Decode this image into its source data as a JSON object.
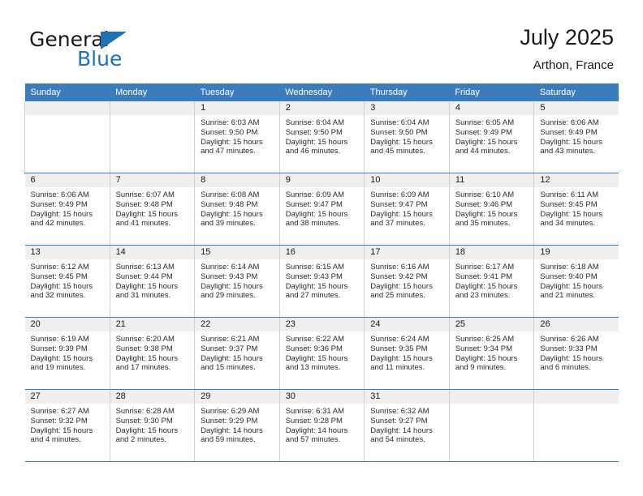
{
  "brand": {
    "name_part1": "General",
    "name_part2": "Blue",
    "flag_color": "#1e72b8"
  },
  "header": {
    "title": "July 2025",
    "subtitle": "Arthon, France",
    "header_bg": "#3a7cbe",
    "daynum_bg": "#efefef"
  },
  "weekday_headers": [
    "Sunday",
    "Monday",
    "Tuesday",
    "Wednesday",
    "Thursday",
    "Friday",
    "Saturday"
  ],
  "weeks": [
    [
      {
        "day": "",
        "sunrise": "",
        "sunset": "",
        "daylight1": "",
        "daylight2": ""
      },
      {
        "day": "",
        "sunrise": "",
        "sunset": "",
        "daylight1": "",
        "daylight2": ""
      },
      {
        "day": "1",
        "sunrise": "Sunrise: 6:03 AM",
        "sunset": "Sunset: 9:50 PM",
        "daylight1": "Daylight: 15 hours",
        "daylight2": "and 47 minutes."
      },
      {
        "day": "2",
        "sunrise": "Sunrise: 6:04 AM",
        "sunset": "Sunset: 9:50 PM",
        "daylight1": "Daylight: 15 hours",
        "daylight2": "and 46 minutes."
      },
      {
        "day": "3",
        "sunrise": "Sunrise: 6:04 AM",
        "sunset": "Sunset: 9:50 PM",
        "daylight1": "Daylight: 15 hours",
        "daylight2": "and 45 minutes."
      },
      {
        "day": "4",
        "sunrise": "Sunrise: 6:05 AM",
        "sunset": "Sunset: 9:49 PM",
        "daylight1": "Daylight: 15 hours",
        "daylight2": "and 44 minutes."
      },
      {
        "day": "5",
        "sunrise": "Sunrise: 6:06 AM",
        "sunset": "Sunset: 9:49 PM",
        "daylight1": "Daylight: 15 hours",
        "daylight2": "and 43 minutes."
      }
    ],
    [
      {
        "day": "6",
        "sunrise": "Sunrise: 6:06 AM",
        "sunset": "Sunset: 9:49 PM",
        "daylight1": "Daylight: 15 hours",
        "daylight2": "and 42 minutes."
      },
      {
        "day": "7",
        "sunrise": "Sunrise: 6:07 AM",
        "sunset": "Sunset: 9:48 PM",
        "daylight1": "Daylight: 15 hours",
        "daylight2": "and 41 minutes."
      },
      {
        "day": "8",
        "sunrise": "Sunrise: 6:08 AM",
        "sunset": "Sunset: 9:48 PM",
        "daylight1": "Daylight: 15 hours",
        "daylight2": "and 39 minutes."
      },
      {
        "day": "9",
        "sunrise": "Sunrise: 6:09 AM",
        "sunset": "Sunset: 9:47 PM",
        "daylight1": "Daylight: 15 hours",
        "daylight2": "and 38 minutes."
      },
      {
        "day": "10",
        "sunrise": "Sunrise: 6:09 AM",
        "sunset": "Sunset: 9:47 PM",
        "daylight1": "Daylight: 15 hours",
        "daylight2": "and 37 minutes."
      },
      {
        "day": "11",
        "sunrise": "Sunrise: 6:10 AM",
        "sunset": "Sunset: 9:46 PM",
        "daylight1": "Daylight: 15 hours",
        "daylight2": "and 35 minutes."
      },
      {
        "day": "12",
        "sunrise": "Sunrise: 6:11 AM",
        "sunset": "Sunset: 9:45 PM",
        "daylight1": "Daylight: 15 hours",
        "daylight2": "and 34 minutes."
      }
    ],
    [
      {
        "day": "13",
        "sunrise": "Sunrise: 6:12 AM",
        "sunset": "Sunset: 9:45 PM",
        "daylight1": "Daylight: 15 hours",
        "daylight2": "and 32 minutes."
      },
      {
        "day": "14",
        "sunrise": "Sunrise: 6:13 AM",
        "sunset": "Sunset: 9:44 PM",
        "daylight1": "Daylight: 15 hours",
        "daylight2": "and 31 minutes."
      },
      {
        "day": "15",
        "sunrise": "Sunrise: 6:14 AM",
        "sunset": "Sunset: 9:43 PM",
        "daylight1": "Daylight: 15 hours",
        "daylight2": "and 29 minutes."
      },
      {
        "day": "16",
        "sunrise": "Sunrise: 6:15 AM",
        "sunset": "Sunset: 9:43 PM",
        "daylight1": "Daylight: 15 hours",
        "daylight2": "and 27 minutes."
      },
      {
        "day": "17",
        "sunrise": "Sunrise: 6:16 AM",
        "sunset": "Sunset: 9:42 PM",
        "daylight1": "Daylight: 15 hours",
        "daylight2": "and 25 minutes."
      },
      {
        "day": "18",
        "sunrise": "Sunrise: 6:17 AM",
        "sunset": "Sunset: 9:41 PM",
        "daylight1": "Daylight: 15 hours",
        "daylight2": "and 23 minutes."
      },
      {
        "day": "19",
        "sunrise": "Sunrise: 6:18 AM",
        "sunset": "Sunset: 9:40 PM",
        "daylight1": "Daylight: 15 hours",
        "daylight2": "and 21 minutes."
      }
    ],
    [
      {
        "day": "20",
        "sunrise": "Sunrise: 6:19 AM",
        "sunset": "Sunset: 9:39 PM",
        "daylight1": "Daylight: 15 hours",
        "daylight2": "and 19 minutes."
      },
      {
        "day": "21",
        "sunrise": "Sunrise: 6:20 AM",
        "sunset": "Sunset: 9:38 PM",
        "daylight1": "Daylight: 15 hours",
        "daylight2": "and 17 minutes."
      },
      {
        "day": "22",
        "sunrise": "Sunrise: 6:21 AM",
        "sunset": "Sunset: 9:37 PM",
        "daylight1": "Daylight: 15 hours",
        "daylight2": "and 15 minutes."
      },
      {
        "day": "23",
        "sunrise": "Sunrise: 6:22 AM",
        "sunset": "Sunset: 9:36 PM",
        "daylight1": "Daylight: 15 hours",
        "daylight2": "and 13 minutes."
      },
      {
        "day": "24",
        "sunrise": "Sunrise: 6:24 AM",
        "sunset": "Sunset: 9:35 PM",
        "daylight1": "Daylight: 15 hours",
        "daylight2": "and 11 minutes."
      },
      {
        "day": "25",
        "sunrise": "Sunrise: 6:25 AM",
        "sunset": "Sunset: 9:34 PM",
        "daylight1": "Daylight: 15 hours",
        "daylight2": "and 9 minutes."
      },
      {
        "day": "26",
        "sunrise": "Sunrise: 6:26 AM",
        "sunset": "Sunset: 9:33 PM",
        "daylight1": "Daylight: 15 hours",
        "daylight2": "and 6 minutes."
      }
    ],
    [
      {
        "day": "27",
        "sunrise": "Sunrise: 6:27 AM",
        "sunset": "Sunset: 9:32 PM",
        "daylight1": "Daylight: 15 hours",
        "daylight2": "and 4 minutes."
      },
      {
        "day": "28",
        "sunrise": "Sunrise: 6:28 AM",
        "sunset": "Sunset: 9:30 PM",
        "daylight1": "Daylight: 15 hours",
        "daylight2": "and 2 minutes."
      },
      {
        "day": "29",
        "sunrise": "Sunrise: 6:29 AM",
        "sunset": "Sunset: 9:29 PM",
        "daylight1": "Daylight: 14 hours",
        "daylight2": "and 59 minutes."
      },
      {
        "day": "30",
        "sunrise": "Sunrise: 6:31 AM",
        "sunset": "Sunset: 9:28 PM",
        "daylight1": "Daylight: 14 hours",
        "daylight2": "and 57 minutes."
      },
      {
        "day": "31",
        "sunrise": "Sunrise: 6:32 AM",
        "sunset": "Sunset: 9:27 PM",
        "daylight1": "Daylight: 14 hours",
        "daylight2": "and 54 minutes."
      },
      {
        "day": "",
        "sunrise": "",
        "sunset": "",
        "daylight1": "",
        "daylight2": ""
      },
      {
        "day": "",
        "sunrise": "",
        "sunset": "",
        "daylight1": "",
        "daylight2": ""
      }
    ]
  ]
}
